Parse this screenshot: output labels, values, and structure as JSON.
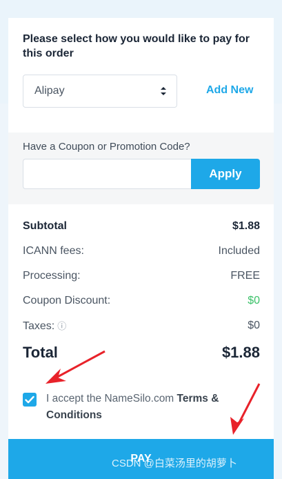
{
  "payment": {
    "heading": "Please select how you would like to pay for this order",
    "method_selected": "Alipay",
    "add_new_label": "Add New"
  },
  "coupon": {
    "label": "Have a Coupon or Promotion Code?",
    "input_value": "",
    "apply_label": "Apply"
  },
  "summary": {
    "subtotal_label": "Subtotal",
    "subtotal_value": "$1.88",
    "icann_label": "ICANN fees:",
    "icann_value": "Included",
    "processing_label": "Processing:",
    "processing_value": "FREE",
    "discount_label": "Coupon Discount:",
    "discount_value": "$0",
    "taxes_label": "Taxes:",
    "taxes_value": "$0",
    "total_label": "Total",
    "total_value": "$1.88"
  },
  "terms": {
    "prefix": "I accept the NameSilo.com",
    "link": "Terms & Conditions",
    "checked": true
  },
  "pay_label": "PAY",
  "watermark": "CSDN @白菜汤里的胡萝卜",
  "colors": {
    "accent": "#1ea8e8",
    "discount_green": "#3cc26a",
    "annotation_red": "#e8222a"
  },
  "icons": [
    "select-arrows-icon",
    "help-icon",
    "checkmark-icon",
    "annotation-arrow-icon"
  ]
}
